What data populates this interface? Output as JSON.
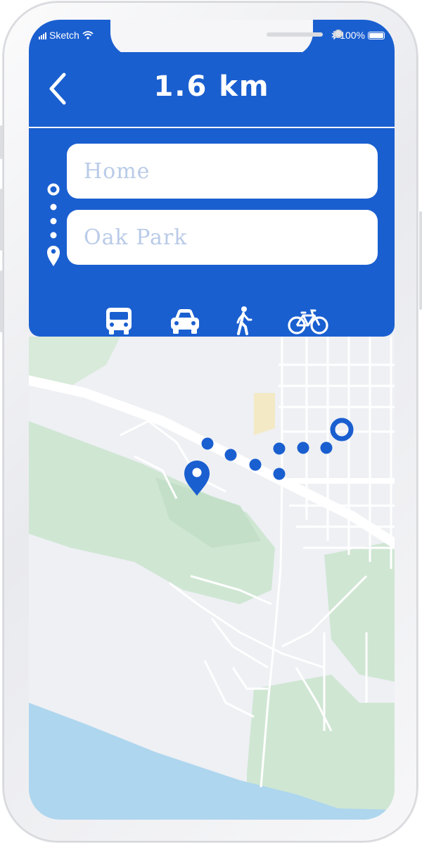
{
  "status_bar": {
    "carrier": "Sketch",
    "battery": "100%"
  },
  "header": {
    "title": "1.6 km"
  },
  "route": {
    "from_placeholder": "Home",
    "to_placeholder": "Oak Park"
  },
  "transport_modes": [
    {
      "name": "bus",
      "icon": "bus-icon"
    },
    {
      "name": "car",
      "icon": "car-icon"
    },
    {
      "name": "walk",
      "icon": "walk-icon"
    },
    {
      "name": "bike",
      "icon": "bike-icon"
    }
  ],
  "colors": {
    "accent": "#1a5fd0",
    "map_park": "#cfe6d3",
    "map_water": "#aed6ee",
    "map_land": "#eef0f4"
  }
}
